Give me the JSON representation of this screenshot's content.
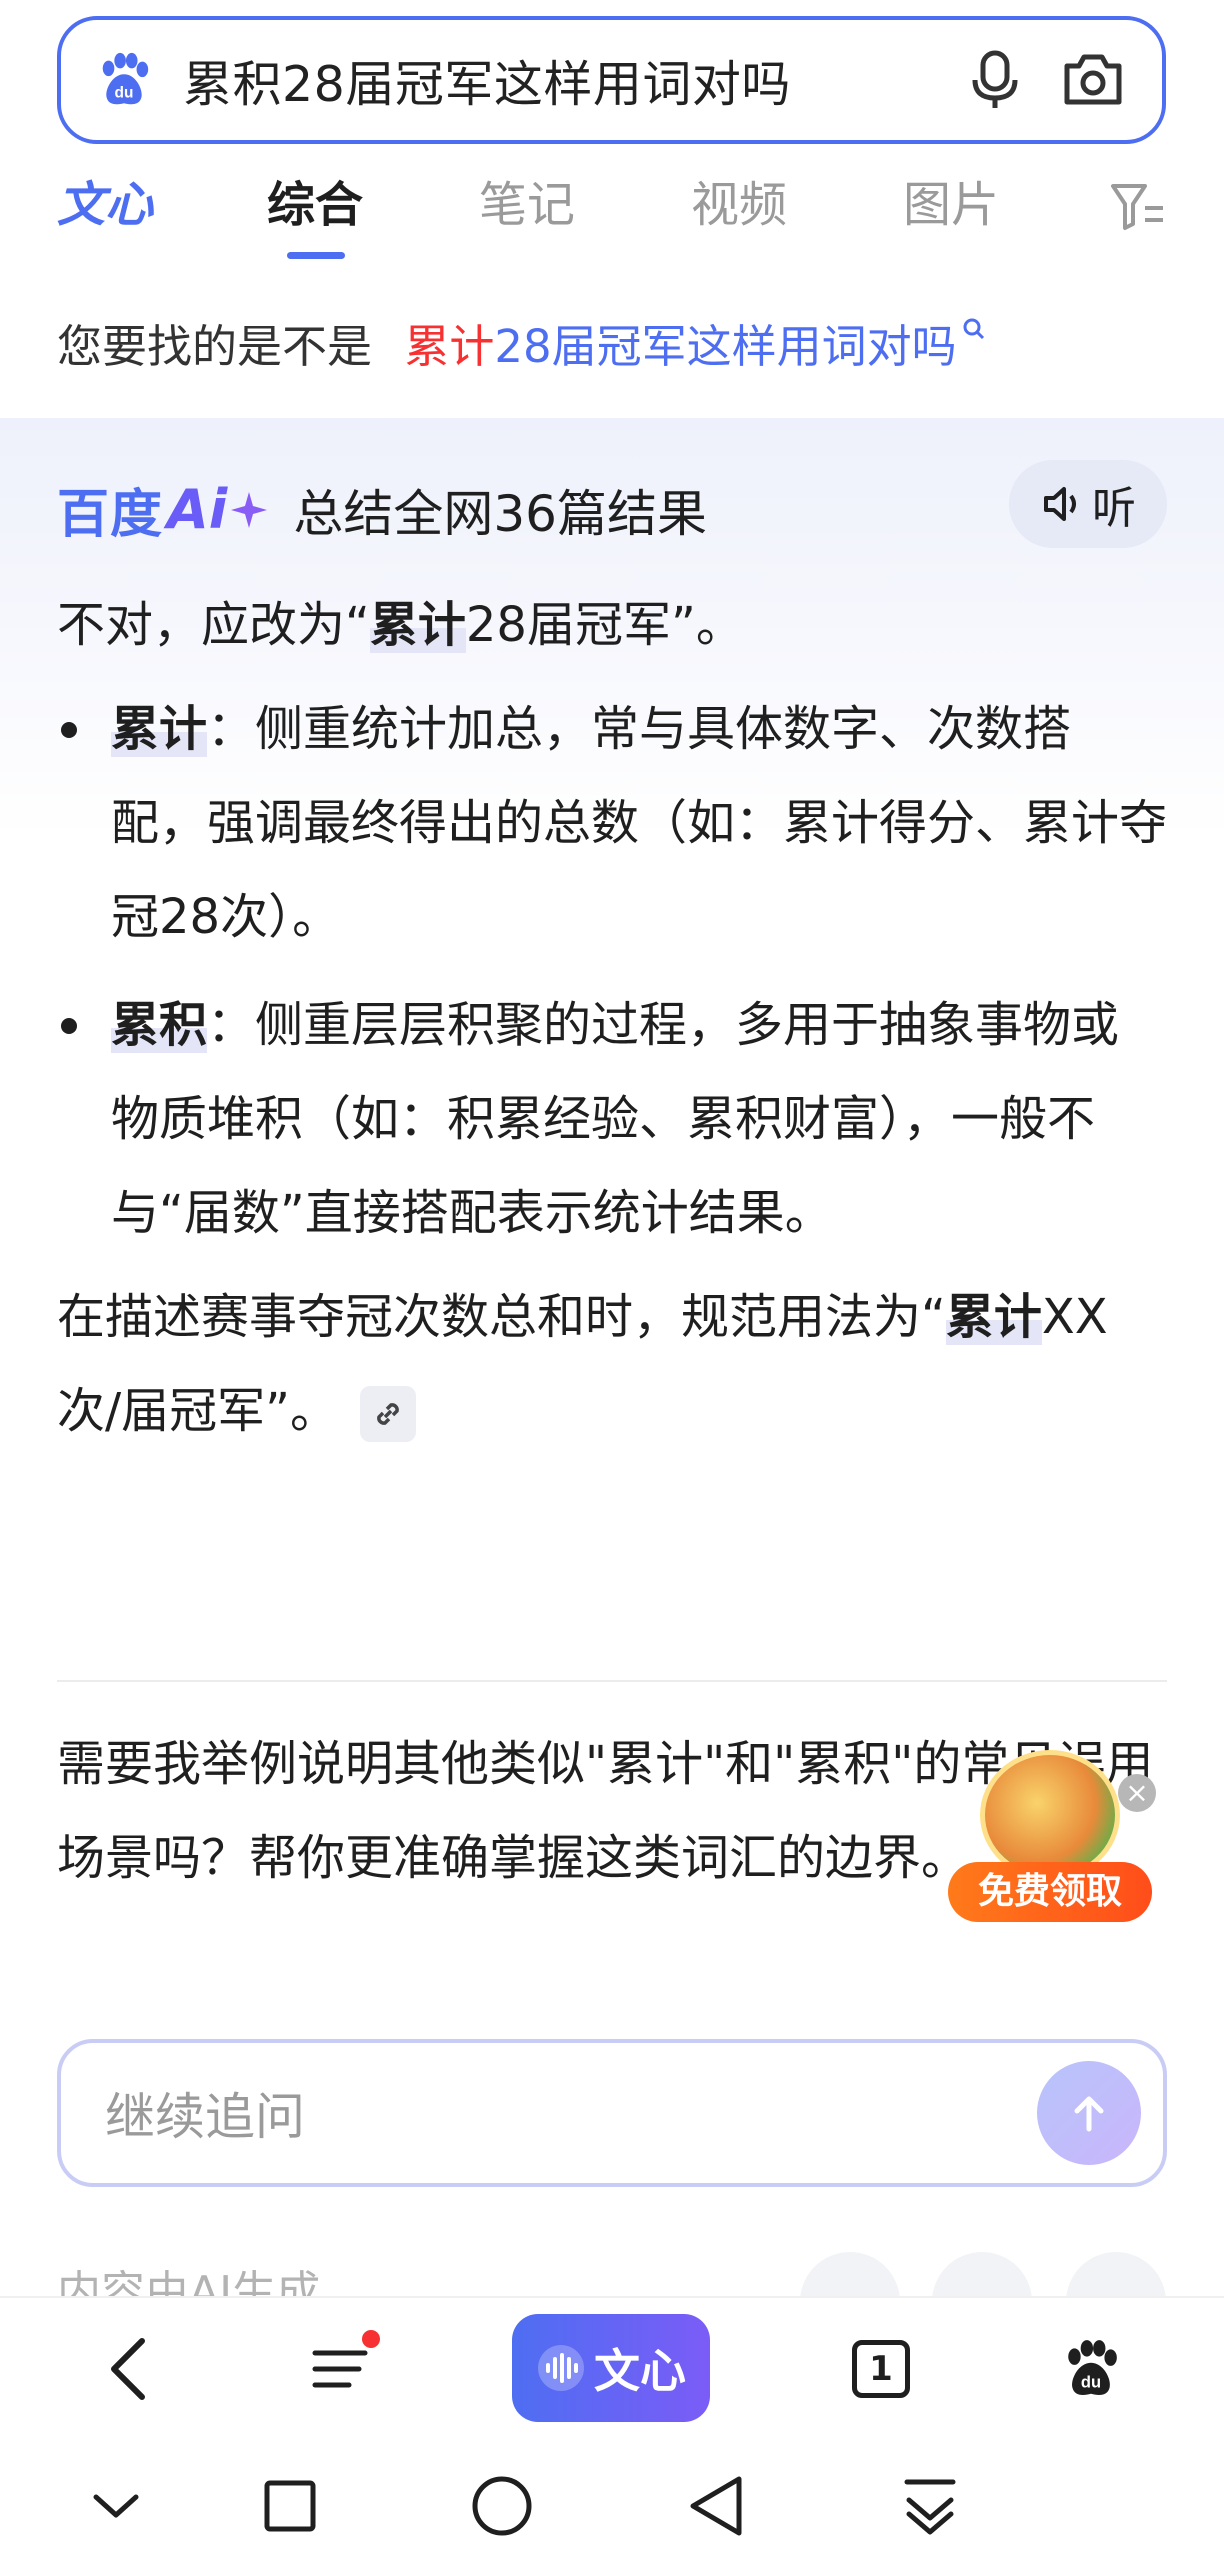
{
  "search": {
    "query": "累积28届冠军这样用词对吗",
    "logo_icon": "baidu-paw-icon"
  },
  "tabs": [
    {
      "label": "文心"
    },
    {
      "label": "综合"
    },
    {
      "label": "笔记"
    },
    {
      "label": "视频"
    },
    {
      "label": "图片"
    }
  ],
  "suggestion": {
    "prefix": "您要找的是不是",
    "alt_highlight": "累计",
    "alt_rest": "28届冠军这样用词对吗"
  },
  "ai": {
    "logo_cn": "百度",
    "logo_ai": "Ai",
    "summary": "总结全网36篇结果",
    "listen_label": "听",
    "intro_pre": "不对，应改为“",
    "intro_kw": "累计",
    "intro_post": "28届冠军”。",
    "bullets": [
      {
        "kw": "累计",
        "text": "：侧重统计加总，常与具体数字、次数搭配，强调最终得出的总数（如：累计得分、累计夺冠28次）。"
      },
      {
        "kw": "累积",
        "text": "：侧重层层积聚的过程，多用于抽象事物或物质堆积（如：积累经验、累积财富），一般不与“届数”直接搭配表示统计结果。"
      }
    ],
    "conclusion_pre": "在描述赛事夺冠次数总和时，规范用法为“",
    "conclusion_kw": "累计",
    "conclusion_post": "XX次/届冠军”。",
    "followup": "需要我举例说明其他类似\"累计\"和\"累积\"的常见误用场景吗？帮你更准确掌握这类词汇的边界。",
    "input_placeholder": "继续追问",
    "footnote": "内容由AI生成"
  },
  "promo": {
    "label": "免费领取",
    "close": "×"
  },
  "toolbar": {
    "wenxin_label": "文心",
    "tab_count": "1"
  },
  "colors": {
    "brand_blue": "#4e6ef2",
    "highlight_red": "#f73131",
    "promo_orange": "#ff5a1a"
  }
}
